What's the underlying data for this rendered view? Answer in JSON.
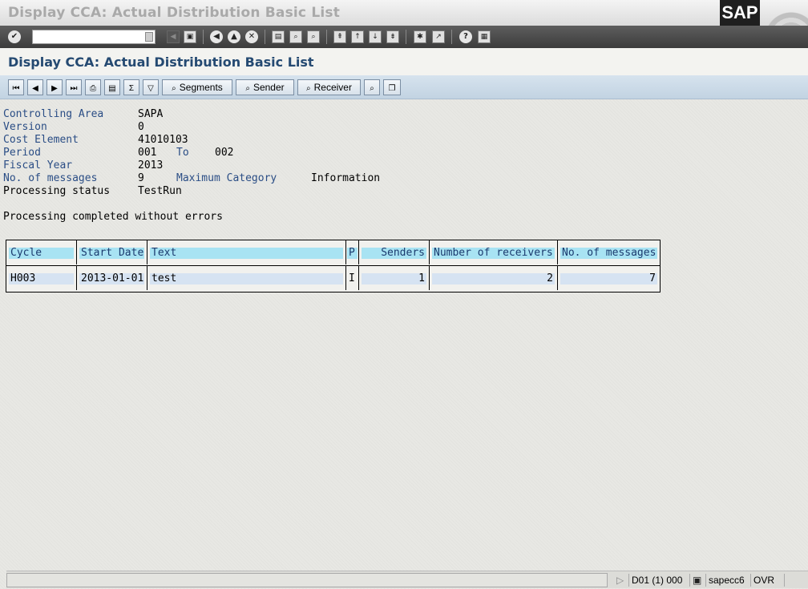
{
  "window": {
    "title": "Display CCA: Actual Distribution Basic List",
    "logo": "SAP"
  },
  "system_toolbar": {
    "command_field_value": "",
    "icons": [
      "enter-icon",
      "back-icon",
      "exit-icon",
      "cancel-icon",
      "print-icon",
      "find-icon",
      "find-next-icon",
      "first-page-icon",
      "prev-page-icon",
      "next-page-icon",
      "last-page-icon",
      "new-session-icon",
      "shortcut-icon",
      "help-icon",
      "customize-layout-icon"
    ]
  },
  "screen": {
    "title": "Display CCA: Actual Distribution Basic List"
  },
  "app_toolbar": {
    "segments_label": "Segments",
    "sender_label": "Sender",
    "receiver_label": "Receiver"
  },
  "header": {
    "controlling_area_label": "Controlling Area",
    "controlling_area_value": "SAPA",
    "version_label": "Version",
    "version_value": "0",
    "cost_element_label": "Cost Element",
    "cost_element_value": "41010103",
    "period_label": "Period",
    "period_from": "001",
    "period_to_label": "To",
    "period_to": "002",
    "fiscal_year_label": "Fiscal Year",
    "fiscal_year_value": "2013",
    "messages_label": "No. of messages",
    "messages_value": "9",
    "max_category_label": "Maximum Category",
    "max_category_value": "Information",
    "processing_status_label": "Processing status",
    "processing_status_value": "TestRun",
    "completion_message": "Processing completed without errors"
  },
  "table": {
    "columns": [
      "Cycle",
      "Start Date",
      "Text",
      "P",
      "Senders",
      "Number of receivers",
      "No. of messages"
    ],
    "rows": [
      [
        "H003",
        "2013-01-01",
        "test",
        "I",
        "1",
        "2",
        "7"
      ]
    ]
  },
  "status_bar": {
    "system": "D01 (1) 000",
    "server": "sapecc6",
    "mode": "OVR"
  }
}
